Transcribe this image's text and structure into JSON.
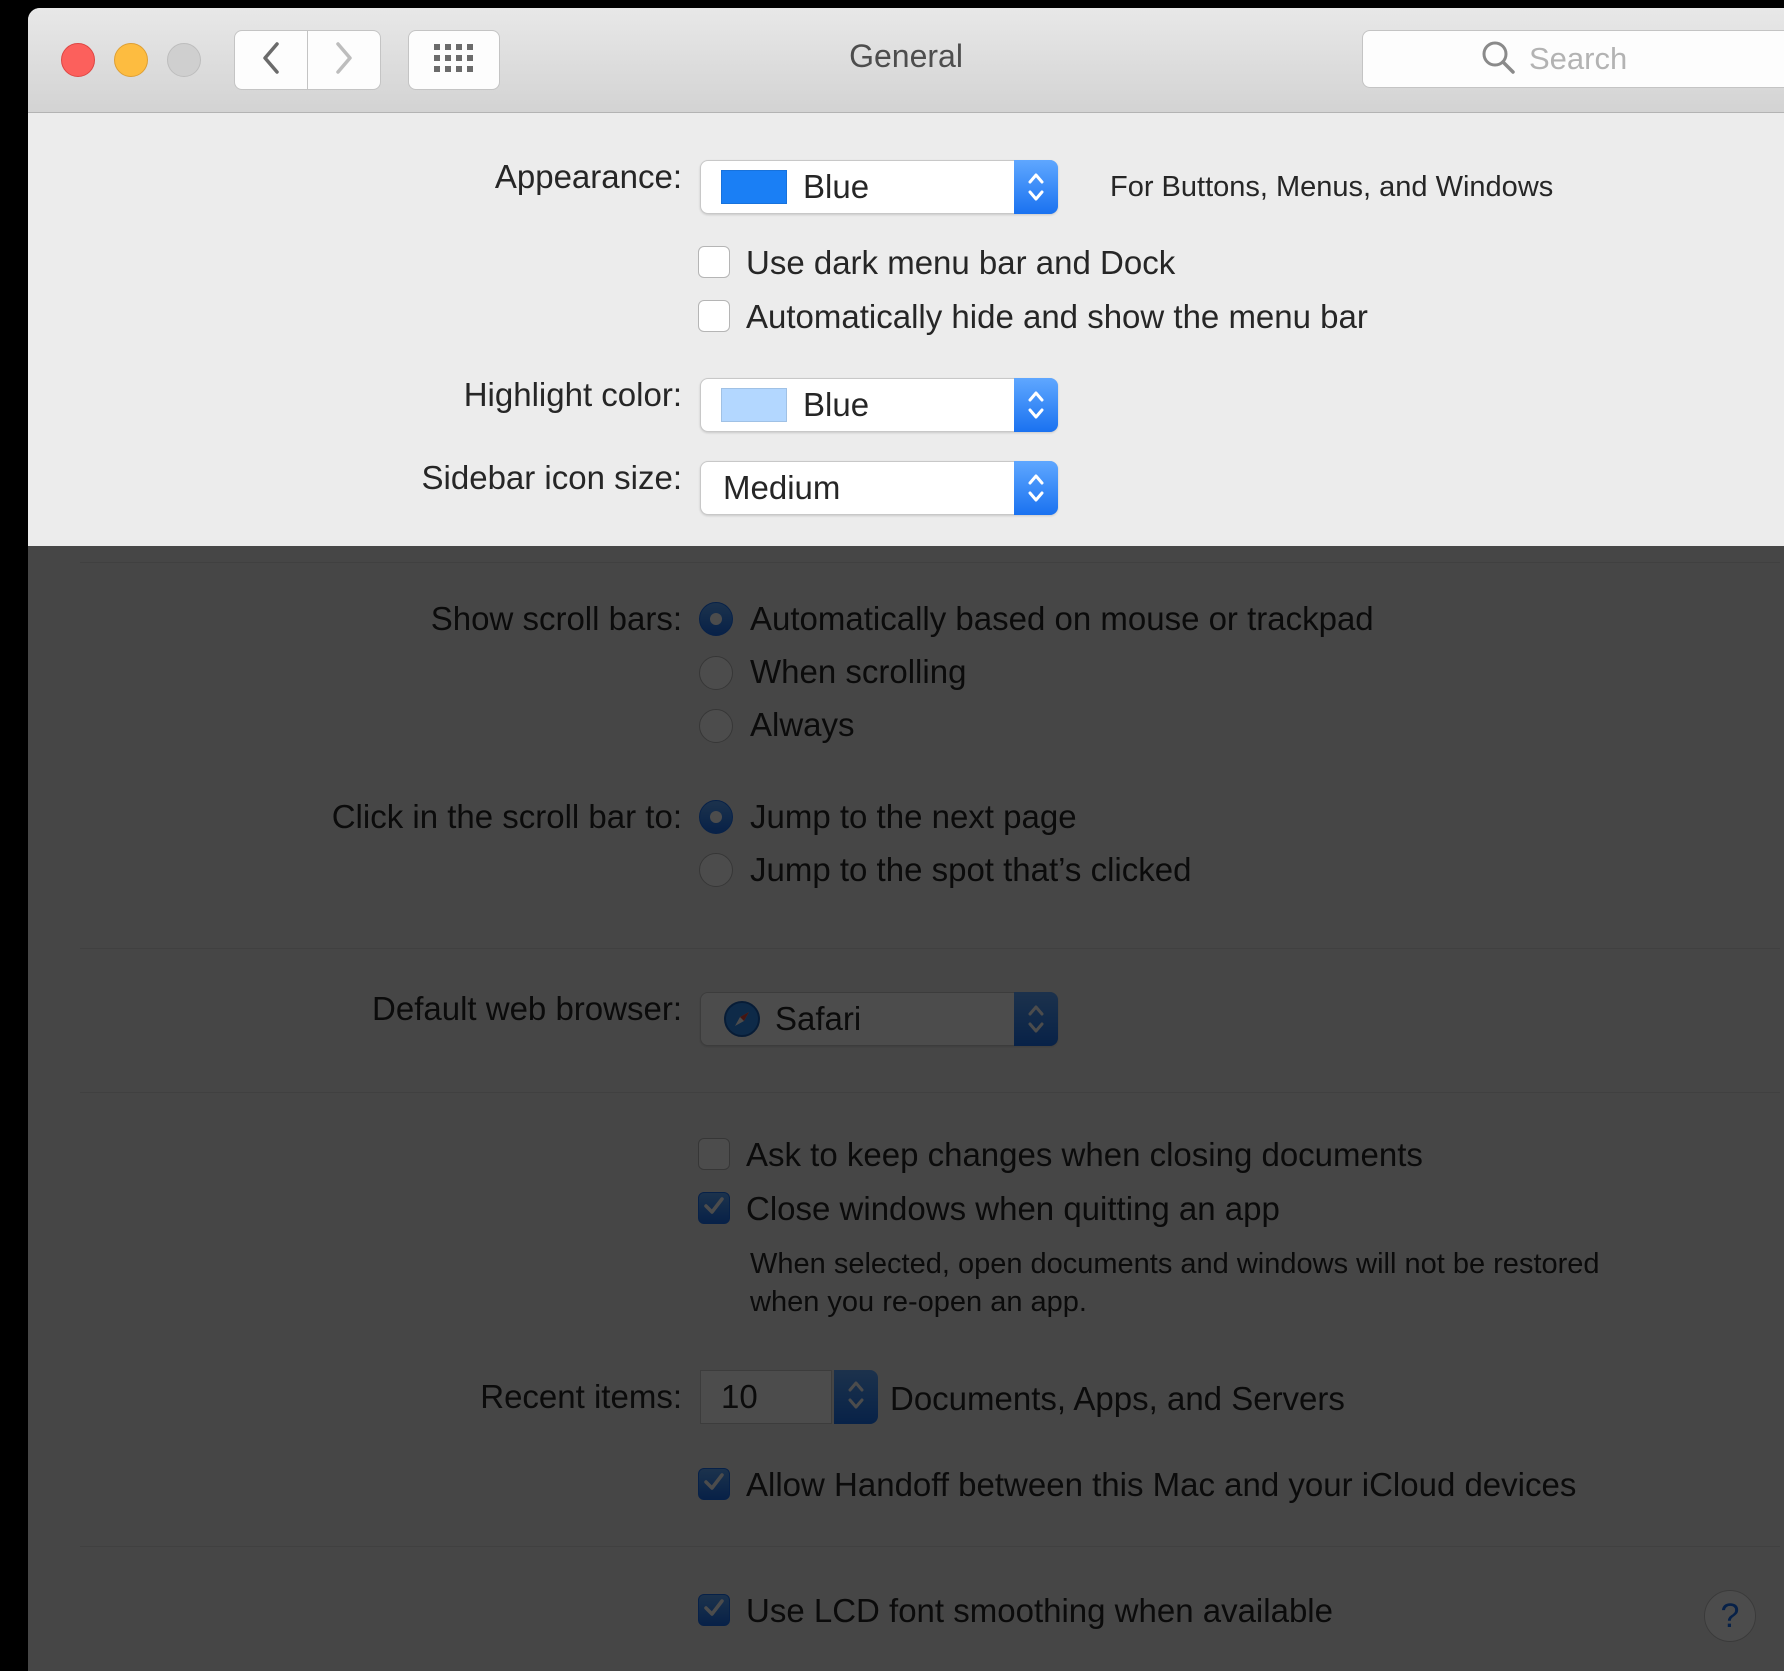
{
  "window": {
    "title": "General",
    "search_placeholder": "Search",
    "icons": {
      "back": "chevron-left-icon",
      "forward": "chevron-right-icon",
      "show_all": "grid-icon",
      "search": "search-icon"
    }
  },
  "appearance": {
    "label": "Appearance:",
    "value": "Blue",
    "swatch_color": "#1a7ff5",
    "note": "For Buttons, Menus, and Windows"
  },
  "checkboxes_top": [
    {
      "label": "Use dark menu bar and Dock",
      "checked": false
    },
    {
      "label": "Automatically hide and show the menu bar",
      "checked": false
    }
  ],
  "highlight": {
    "label": "Highlight color:",
    "value": "Blue",
    "swatch_color": "#b3d7ff"
  },
  "sidebar_icon_size": {
    "label": "Sidebar icon size:",
    "value": "Medium"
  },
  "scroll_bars": {
    "label": "Show scroll bars:",
    "options": [
      {
        "label": "Automatically based on mouse or trackpad",
        "selected": true
      },
      {
        "label": "When scrolling",
        "selected": false
      },
      {
        "label": "Always",
        "selected": false
      }
    ]
  },
  "click_scroll": {
    "label": "Click in the scroll bar to:",
    "options": [
      {
        "label": "Jump to the next page",
        "selected": true
      },
      {
        "label": "Jump to the spot that’s clicked",
        "selected": false
      }
    ]
  },
  "browser": {
    "label": "Default web browser:",
    "value": "Safari",
    "icon": "safari-icon"
  },
  "documents": {
    "ask_keep": {
      "label": "Ask to keep changes when closing documents",
      "checked": false
    },
    "close_windows": {
      "label": "Close windows when quitting an app",
      "checked": true
    },
    "close_note_line1": "When selected, open documents and windows will not be restored",
    "close_note_line2": "when you re-open an app."
  },
  "recent": {
    "label": "Recent items:",
    "value": "10",
    "note": "Documents, Apps, and Servers"
  },
  "handoff": {
    "label": "Allow Handoff between this Mac and your iCloud devices",
    "checked": true
  },
  "lcd": {
    "label": "Use LCD font smoothing when available",
    "checked": true
  },
  "help": {
    "label": "?"
  },
  "colors": {
    "accent": "#1a6ff0",
    "window_bg": "#ececec",
    "dim_overlay": "rgba(0,0,0,0.70)"
  }
}
